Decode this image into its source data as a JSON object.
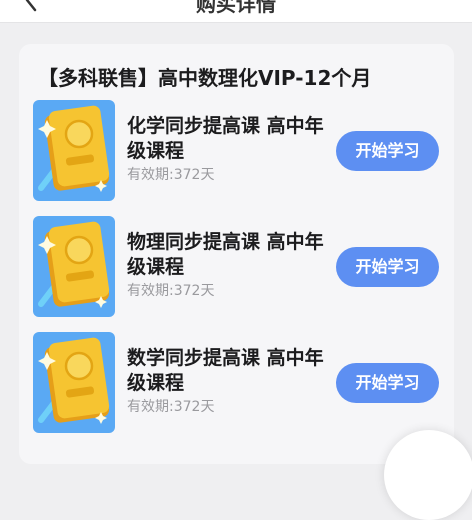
{
  "nav": {
    "title": "购买详情",
    "back_icon": "chevron-left-icon"
  },
  "product": {
    "title": "【多科联售】高中数理化VIP-12个月"
  },
  "courses": [
    {
      "name": "化学同步提高课 高中年级课程",
      "validity_label": "有效期:",
      "validity_value": "372天",
      "button_label": "开始学习",
      "icon": "book-icon"
    },
    {
      "name": "物理同步提高课 高中年级课程",
      "validity_label": "有效期:",
      "validity_value": "372天",
      "button_label": "开始学习",
      "icon": "book-icon"
    },
    {
      "name": "数学同步提高课 高中年级课程",
      "validity_label": "有效期:",
      "validity_value": "372天",
      "button_label": "开始学习",
      "icon": "book-icon"
    }
  ],
  "colors": {
    "accent": "#5d8ff2",
    "thumb_bg": "#5aa9f4",
    "book": "#f6c431"
  }
}
